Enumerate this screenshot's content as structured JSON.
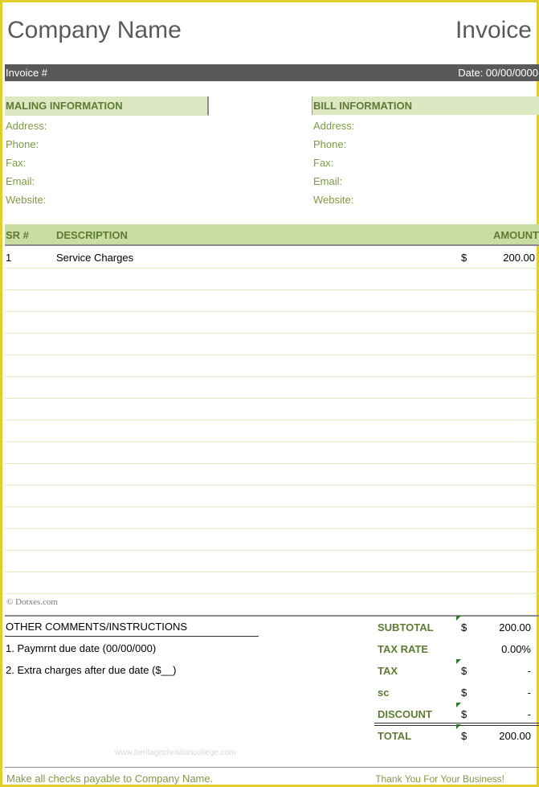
{
  "header": {
    "company": "Company Name",
    "title": "Invoice",
    "invoice_label": "Invoice #",
    "date_label": "Date: 00/00/0000"
  },
  "mailing": {
    "heading": "MALING INFORMATION",
    "fields": [
      "Address:",
      "Phone:",
      "Fax:",
      "Email:",
      "Website:"
    ]
  },
  "billing": {
    "heading": "BILL INFORMATION",
    "fields": [
      "Address:",
      "Phone:",
      "Fax:",
      "Email:",
      "Website:"
    ]
  },
  "table": {
    "headers": {
      "sr": "SR #",
      "description": "DESCRIPTION",
      "amount": "AMOUNT"
    },
    "rows": [
      {
        "sr": "1",
        "description": "Service Charges",
        "currency": "$",
        "amount": "200.00"
      }
    ]
  },
  "copyright": "© Dotxes.com",
  "comments": {
    "heading": "OTHER COMMENTS/INSTRUCTIONS",
    "lines": [
      "1. Paymrnt due date (00/00/000)",
      "2. Extra charges after due date ($__)"
    ]
  },
  "totals": {
    "subtotal": {
      "label": "SUBTOTAL",
      "currency": "$",
      "value": "200.00"
    },
    "tax_rate": {
      "label": "TAX RATE",
      "currency": "",
      "value": "0.00%"
    },
    "tax": {
      "label": "TAX",
      "currency": "$",
      "value": "-"
    },
    "sc": {
      "label": "sc",
      "currency": "$",
      "value": "-"
    },
    "discount": {
      "label": "DISCOUNT",
      "currency": "$",
      "value": "-"
    },
    "total": {
      "label": "TOTAL",
      "currency": "$",
      "value": "200.00"
    }
  },
  "watermark": "www.heritagechristiancollege.com",
  "footer": {
    "left": "Make all checks payable to Company Name.",
    "right": "Thank You For Your Business!"
  }
}
